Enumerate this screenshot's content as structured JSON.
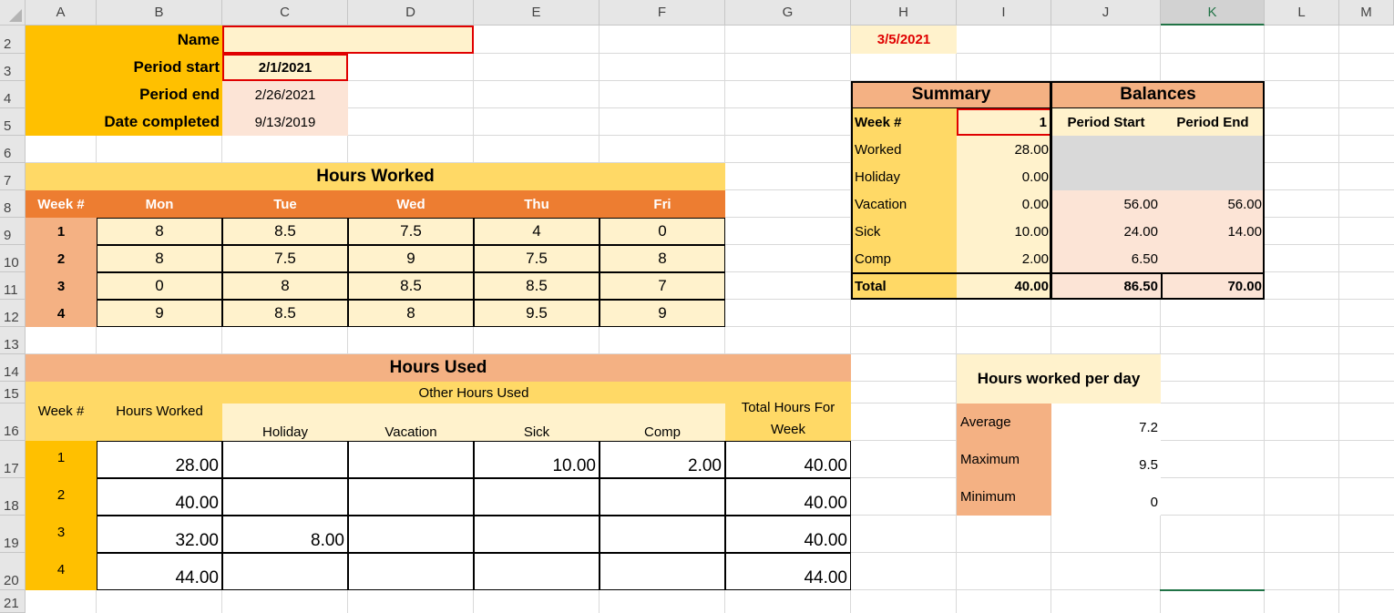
{
  "columns": [
    "A",
    "B",
    "C",
    "D",
    "E",
    "F",
    "G",
    "H",
    "I",
    "J",
    "K",
    "L",
    "M"
  ],
  "rows": [
    "2",
    "3",
    "4",
    "5",
    "6",
    "7",
    "8",
    "9",
    "10",
    "11",
    "12",
    "13",
    "14",
    "15",
    "16",
    "17",
    "18",
    "19",
    "20",
    "21"
  ],
  "selected_column": "K",
  "header_info": {
    "name_label": "Name",
    "period_start_label": "Period start",
    "period_start": "2/1/2021",
    "period_end_label": "Period end",
    "period_end": "2/26/2021",
    "date_completed_label": "Date completed",
    "date_completed": "9/13/2019",
    "today": "3/5/2021"
  },
  "hours_worked": {
    "title": "Hours Worked",
    "headers": [
      "Week #",
      "Mon",
      "Tue",
      "Wed",
      "Thu",
      "Fri"
    ],
    "rows": [
      {
        "week": "1",
        "values": [
          "8",
          "8.5",
          "7.5",
          "4",
          "0"
        ]
      },
      {
        "week": "2",
        "values": [
          "8",
          "7.5",
          "9",
          "7.5",
          "8"
        ]
      },
      {
        "week": "3",
        "values": [
          "0",
          "8",
          "8.5",
          "8.5",
          "7"
        ]
      },
      {
        "week": "4",
        "values": [
          "9",
          "8.5",
          "8",
          "9.5",
          "9"
        ]
      }
    ]
  },
  "summary": {
    "title": "Summary",
    "week_label": "Week #",
    "week_value": "1",
    "rows": [
      {
        "label": "Worked",
        "value": "28.00"
      },
      {
        "label": "Holiday",
        "value": "0.00"
      },
      {
        "label": "Vacation",
        "value": "0.00"
      },
      {
        "label": "Sick",
        "value": "10.00"
      },
      {
        "label": "Comp",
        "value": "2.00"
      },
      {
        "label": "Total",
        "value": "40.00"
      }
    ]
  },
  "balances": {
    "title": "Balances",
    "period_start_label": "Period Start",
    "period_end_label": "Period End",
    "vacation": [
      "56.00",
      "56.00"
    ],
    "sick": [
      "24.00",
      "14.00"
    ],
    "comp": [
      "6.50",
      ""
    ],
    "total": [
      "86.50",
      "70.00"
    ]
  },
  "hours_used": {
    "title": "Hours Used",
    "week_label": "Week #",
    "hours_worked_label": "Hours Worked",
    "other_label": "Other Hours Used",
    "sub_headers": [
      "Holiday",
      "Vacation",
      "Sick",
      "Comp"
    ],
    "total_label_1": "Total Hours For",
    "total_label_2": "Week",
    "rows": [
      {
        "week": "1",
        "worked": "28.00",
        "holiday": "",
        "vacation": "",
        "sick": "10.00",
        "comp": "2.00",
        "total": "40.00"
      },
      {
        "week": "2",
        "worked": "40.00",
        "holiday": "",
        "vacation": "",
        "sick": "",
        "comp": "",
        "total": "40.00"
      },
      {
        "week": "3",
        "worked": "32.00",
        "holiday": "8.00",
        "vacation": "",
        "sick": "",
        "comp": "",
        "total": "40.00"
      },
      {
        "week": "4",
        "worked": "44.00",
        "holiday": "",
        "vacation": "",
        "sick": "",
        "comp": "",
        "total": "44.00"
      }
    ]
  },
  "per_day": {
    "title": "Hours worked per day",
    "rows": [
      {
        "label": "Average",
        "value": "7.2"
      },
      {
        "label": "Maximum",
        "value": "9.5"
      },
      {
        "label": "Minimum",
        "value": "0"
      }
    ]
  },
  "colors": {
    "gold": "#ffc000",
    "light_yellow": "#fff2cc",
    "yellow": "#ffd966",
    "orange": "#ed7d31",
    "salmon": "#f4b183",
    "pink": "#fce4d6",
    "gray": "#d9d9d9",
    "red": "#e00000",
    "green": "#217346"
  }
}
